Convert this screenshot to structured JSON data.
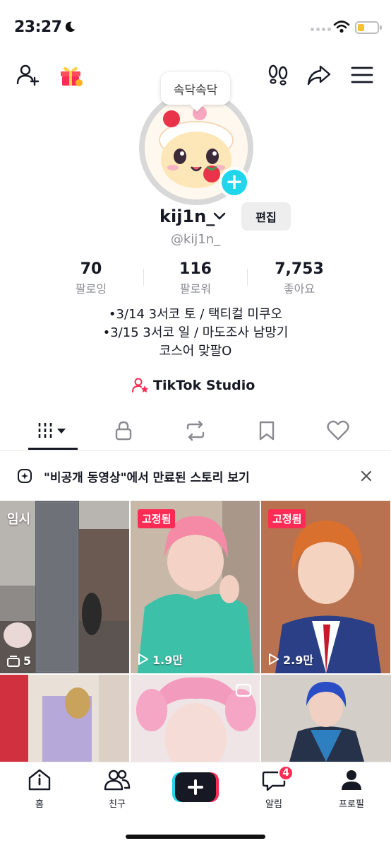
{
  "status_bar": {
    "time": "23:27"
  },
  "header": {
    "bubble_text": "속닥속닥"
  },
  "profile": {
    "username": "kij1n_",
    "handle": "@kij1n_",
    "edit_label": "편집",
    "stats": [
      {
        "value": "70",
        "label": "팔로잉"
      },
      {
        "value": "116",
        "label": "팔로워"
      },
      {
        "value": "7,753",
        "label": "좋아요"
      }
    ],
    "bio_lines": [
      "•3/14 3서코 토 / 택티컬 미쿠오",
      "•3/15 3서코 일 / 마도조사 남망기",
      "코스어 맞팔O"
    ],
    "studio_label": "TikTok Studio"
  },
  "story_banner": {
    "text": "\"비공개 동영상\"에서 만료된 스토리 보기"
  },
  "grid": {
    "tiles": [
      {
        "badge": "임시",
        "views": "5"
      },
      {
        "badge": "고정됨",
        "views": "1.9만"
      },
      {
        "badge": "고정됨",
        "views": "2.9만"
      },
      {
        "badge": "",
        "views": ""
      },
      {
        "badge": "",
        "views": ""
      },
      {
        "badge": "",
        "views": ""
      }
    ]
  },
  "bottom_nav": {
    "items": [
      {
        "label": "홈"
      },
      {
        "label": "친구"
      },
      {
        "label": ""
      },
      {
        "label": "알림",
        "badge": "4"
      },
      {
        "label": "프로필"
      }
    ]
  },
  "colors": {
    "accent": "#fe2c55",
    "cyan": "#20d5ec",
    "text": "#161823",
    "muted": "#8a8b91"
  }
}
